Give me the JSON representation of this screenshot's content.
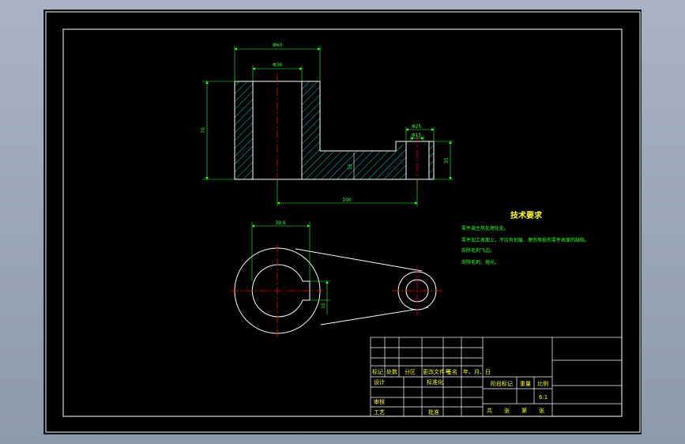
{
  "colors": {
    "background": "#000000",
    "outline": "#ffffff",
    "dimension": "#00ff00",
    "centerline": "#ff0000",
    "hatch": "#00ffff",
    "text": "#ffff33"
  },
  "dimensions": {
    "top_width": "Φ60",
    "bore_diameter": "Φ36",
    "overall_height": "70",
    "small_outer": "Φ25",
    "small_inner": "Φ15",
    "small_height": "35",
    "center_distance": "100",
    "web": "15",
    "keyway_width": "39.6",
    "keyway_depth": "10"
  },
  "tech_requirements": {
    "title": "技术要求",
    "lines": [
      "零件调主热处理化处。",
      "零件加工表面上，不应有划痕、擦伤等损伤零件表面的缺陷。",
      "去除毛刺飞边。",
      "去除毛刺，抛光。"
    ]
  },
  "title_block": {
    "header_row": [
      "标记",
      "处数",
      "分区",
      "更改文件号",
      "签名",
      "年、月、日"
    ],
    "designer": "设计",
    "standardize": "标准化",
    "review": "审核",
    "process": "工艺",
    "approve": "批准",
    "stage_mark": "阶段标记",
    "weight": "重量",
    "scale": "比例",
    "scale_value": "6:1",
    "sheet_info": [
      "共",
      "张",
      "第",
      "张"
    ]
  }
}
